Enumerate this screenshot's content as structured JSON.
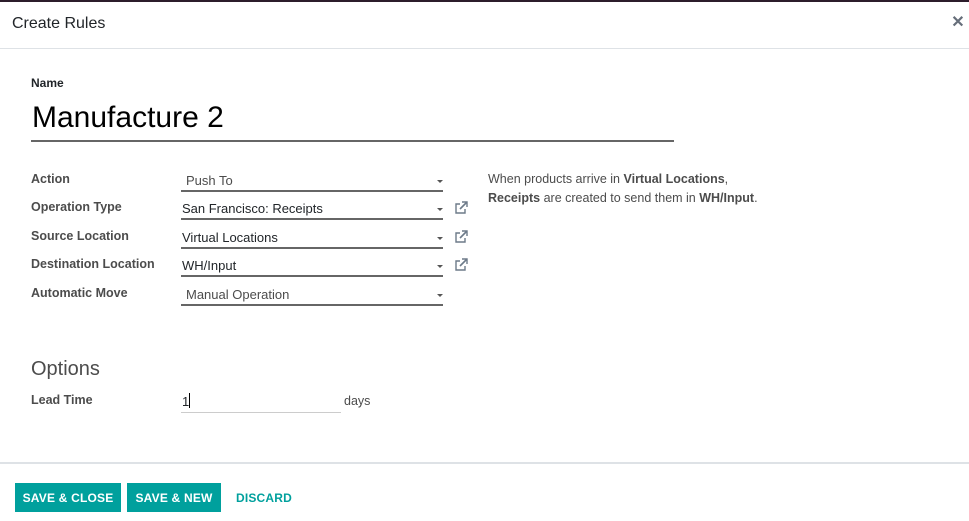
{
  "dialog": {
    "title": "Create Rules",
    "close_icon": "close-icon"
  },
  "form": {
    "name_label": "Name",
    "name_value": "Manufacture 2",
    "fields": [
      {
        "label": "Action",
        "value": "Push To",
        "external_link": false
      },
      {
        "label": "Operation Type",
        "value": "San Francisco: Receipts",
        "external_link": true
      },
      {
        "label": "Source Location",
        "value": "Virtual Locations",
        "external_link": true
      },
      {
        "label": "Destination Location",
        "value": "WH/Input",
        "external_link": true
      },
      {
        "label": "Automatic Move",
        "value": "Manual Operation",
        "external_link": false
      }
    ],
    "help": {
      "part1": "When products arrive in ",
      "bold1": "Virtual Locations",
      "part2": ",",
      "bold2": "Receipts",
      "part3": " are created to send them in ",
      "bold3": "WH/Input",
      "part4": "."
    },
    "options": {
      "title": "Options",
      "lead_time_label": "Lead Time",
      "lead_time_value": "1",
      "lead_time_unit": "days"
    }
  },
  "footer": {
    "save_close": "SAVE & CLOSE",
    "save_new": "SAVE & NEW",
    "discard": "DISCARD"
  },
  "colors": {
    "primary": "#00a09d",
    "text": "#212529",
    "muted": "#4c4c4c"
  }
}
